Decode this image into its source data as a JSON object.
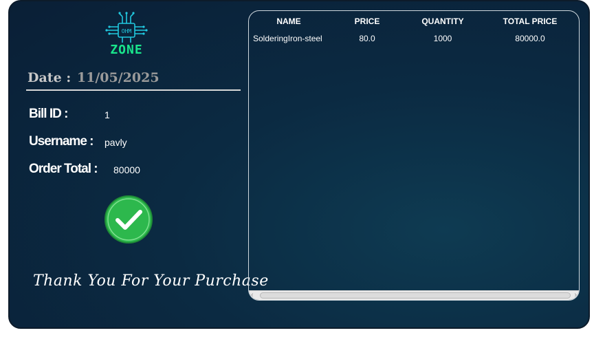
{
  "brand": {
    "chip_text": "OHM",
    "word": "ZONE"
  },
  "receipt": {
    "date_label": "Date :",
    "date_value": "11/05/2025",
    "bill_id_label": "Bill ID :",
    "bill_id_value": "1",
    "username_label": "Username :",
    "username_value": "pavly",
    "order_total_label": "Order Total :",
    "order_total_value": "80000",
    "thanks": "Thank You For Your Purchase"
  },
  "table": {
    "columns": [
      "NAME",
      "PRICE",
      "QUANTITY",
      "TOTAL PRICE"
    ],
    "rows": [
      [
        "SolderingIron-steel",
        "80.0",
        "1000",
        "80000.0"
      ]
    ]
  },
  "colors": {
    "accent": "#19e58c",
    "success": "#2db84d"
  }
}
